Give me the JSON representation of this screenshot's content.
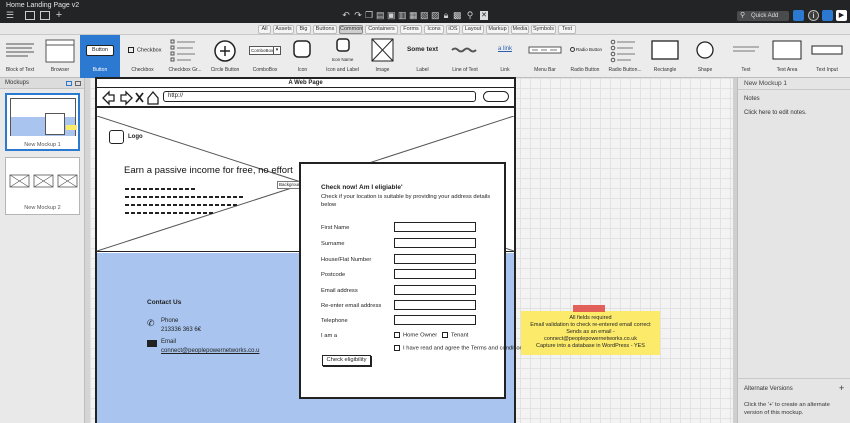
{
  "app": {
    "title": "Home Landing Page v2",
    "quick_add_label": "Quick Add"
  },
  "library_tabs": [
    "All",
    "Assets",
    "Big",
    "Buttons",
    "Common",
    "Containers",
    "Forms",
    "Icons",
    "iOS",
    "Layout",
    "Markup",
    "Media",
    "Symbols",
    "Text"
  ],
  "library_active_tab": "Common",
  "library_items": [
    "Block of Text",
    "Browser",
    "Button",
    "Checkbox",
    "Checkbox Gr...",
    "Circle Button",
    "ComboBox",
    "Icon",
    "Icon and Label",
    "Image",
    "Label",
    "Line of Text",
    "Link",
    "Menu Bar",
    "Radio Button",
    "Radio Button...",
    "Rectangle",
    "Shape",
    "Text",
    "Text Area",
    "Text Input"
  ],
  "library_preview_text": {
    "button": "Button",
    "checkbox": "Checkbox",
    "combobox": "ComboBox",
    "icon_name": "Icon Name",
    "label": "Some text",
    "link": "a link",
    "radio": "Radio Button"
  },
  "left_panel": {
    "header": "Mockups",
    "mockups": [
      "New Mockup 1",
      "New Mockup 2"
    ]
  },
  "right_panel": {
    "title": "New Mockup 1",
    "notes_label": "Notes",
    "notes_hint": "Click here to edit notes.",
    "alt_versions_label": "Alternate Versions",
    "alt_versions_hint": "Click the '+' to create an alternate version of this mockup."
  },
  "mockup": {
    "browser_title": "A Web Page",
    "url": "http://",
    "logo": "Logo",
    "headline": "Earn a passive income for free, no effort",
    "bg_tag": "Backgroun",
    "contact_title": "Contact Us",
    "phone_label": "Phone",
    "phone_value": "213336 363 6€",
    "email_label": "Email",
    "email_value": "connect@peoplepowernetworks.co.u",
    "form": {
      "title": "Check now! Am I eligiable'",
      "subtitle": "Check if your location is suitable by providing your address details below",
      "fields": [
        "First Name",
        "Surname",
        "House/Flat Number",
        "Postcode",
        "Email address",
        "Re-enter email address",
        "Telephone"
      ],
      "i_am_label": "I am a",
      "options": [
        "Home Owner",
        "Tenant"
      ],
      "terms": "I have read and agree the Terms and conditions",
      "submit": "Check eligibility"
    },
    "sticky_note": [
      "All fields required",
      "Email validation to check re-entered email correct",
      "Sends as an email -",
      "connect@peoplepowernetworks.co.uk",
      "Capture into a database in WordPress - YES"
    ]
  },
  "colors": {
    "selection_blue": "#2c79d1",
    "sticky_yellow": "#fceb6b",
    "section_blue": "#a8c4ef"
  }
}
